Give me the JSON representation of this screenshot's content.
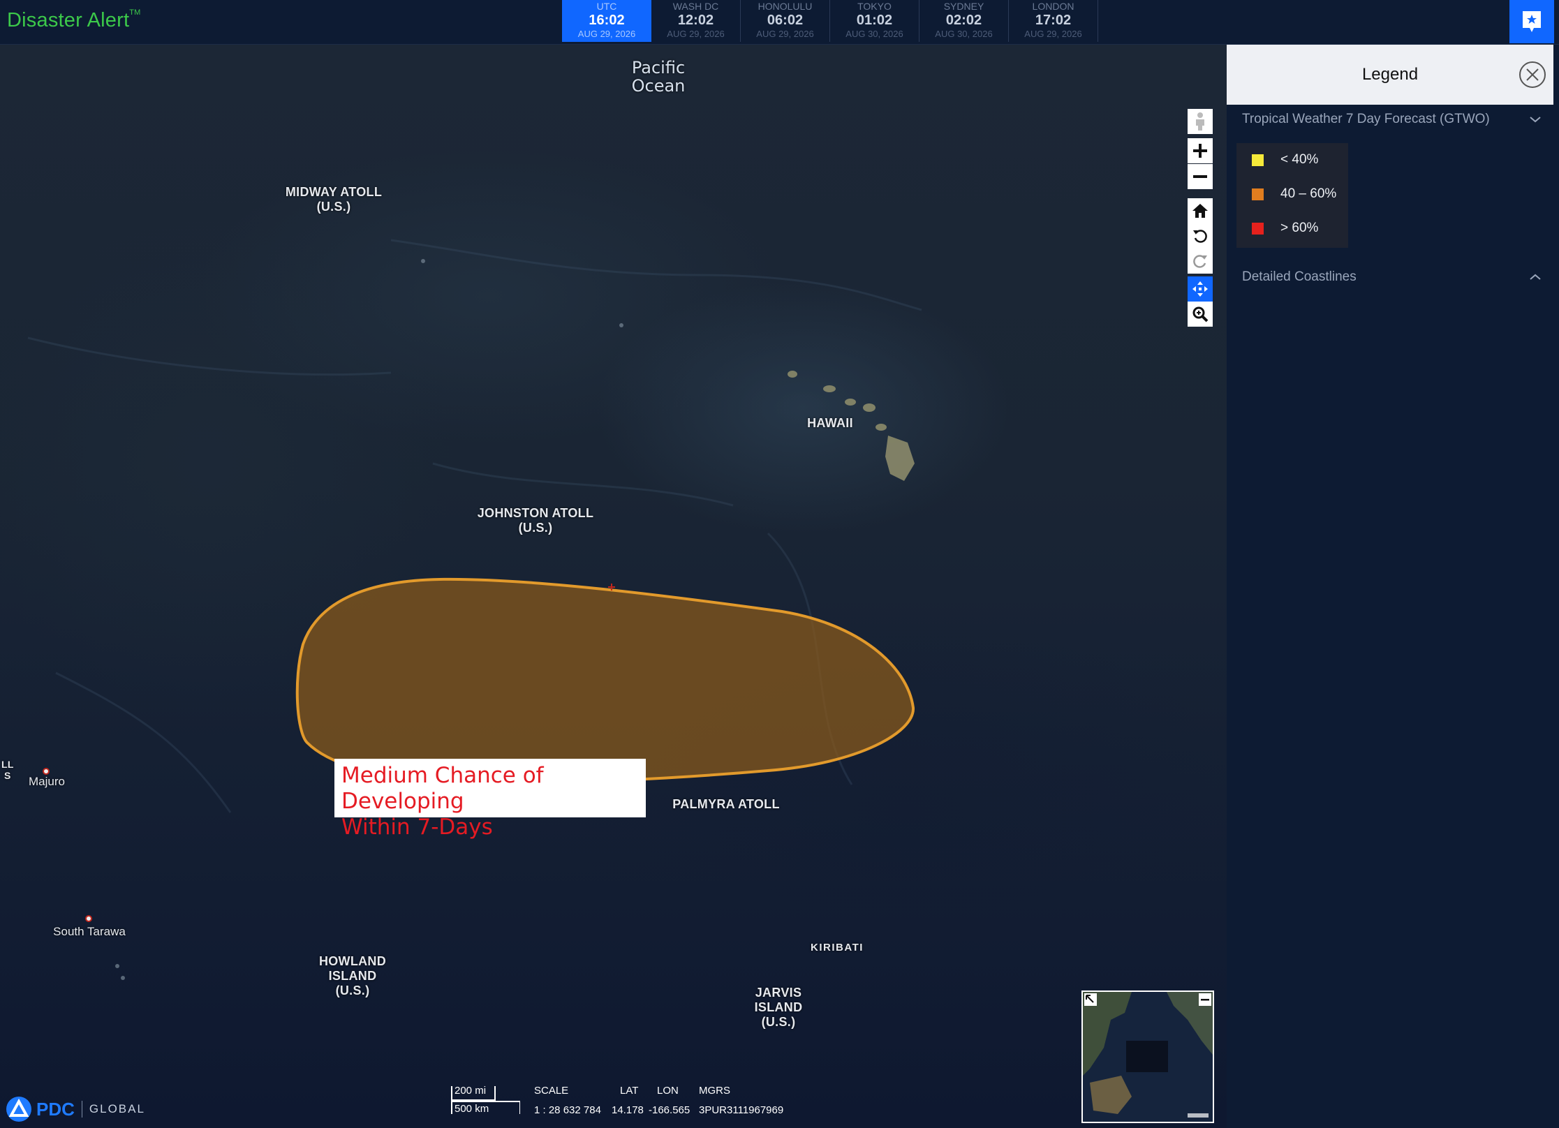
{
  "app": {
    "title": "Disaster Alert",
    "trademark": "TM"
  },
  "clocks": [
    {
      "city": "UTC",
      "time": "16:02",
      "date": "AUG 29, 2026",
      "active": true
    },
    {
      "city": "WASH DC",
      "time": "12:02",
      "date": "AUG 29, 2026",
      "active": false
    },
    {
      "city": "HONOLULU",
      "time": "06:02",
      "date": "AUG 29, 2026",
      "active": false
    },
    {
      "city": "TOKYO",
      "time": "01:02",
      "date": "AUG 30, 2026",
      "active": false
    },
    {
      "city": "SYDNEY",
      "time": "02:02",
      "date": "AUG 30, 2026",
      "active": false
    },
    {
      "city": "LONDON",
      "time": "17:02",
      "date": "AUG 29, 2026",
      "active": false
    }
  ],
  "map": {
    "ocean_label_line1": "Pacific",
    "ocean_label_line2": "Ocean",
    "labels": {
      "midway": {
        "name": "MIDWAY ATOLL",
        "sub": "(U.S.)"
      },
      "hawaii": {
        "name": "HAWAII"
      },
      "johnston": {
        "name": "JOHNSTON ATOLL",
        "sub": "(U.S.)"
      },
      "palmyra": {
        "name": "PALMYRA ATOLL"
      },
      "kiribati": {
        "name": "KIRIBATI"
      },
      "howland": {
        "name": "HOWLAND",
        "sub1": "ISLAND",
        "sub2": "(U.S.)"
      },
      "jarvis": {
        "name": "JARVIS",
        "sub1": "ISLAND",
        "sub2": "(U.S.)"
      }
    },
    "cities": {
      "majuro": "Majuro",
      "south_tarawa": "South Tarawa"
    },
    "edge_label": "LL\nS",
    "forecast_area": {
      "chance": "40 – 60%",
      "color": "#c98a2b"
    },
    "callout_line1": "Medium Chance of Developing",
    "callout_line2": "Within 7-Days"
  },
  "controls": {
    "icons": [
      "street-view-icon",
      "zoom-in-icon",
      "zoom-out-icon",
      "home-icon",
      "rotate-left-icon",
      "rotate-right-icon",
      "pan-icon",
      "zoom-box-icon"
    ]
  },
  "footer": {
    "logo_text": "PDC",
    "logo_sub": "GLOBAL",
    "scale_mi": "200 mi",
    "scale_km": "500 km",
    "scale_label": "SCALE",
    "scale_value": "1 : 28 632 784",
    "lat_label": "LAT",
    "lat_value": "14.178",
    "lon_label": "LON",
    "lon_value": "-166.565",
    "mgrs_label": "MGRS",
    "mgrs_value": "3PUR3111967969"
  },
  "legend": {
    "title": "Legend",
    "section1": "Tropical Weather 7 Day Forecast (GTWO)",
    "items": [
      {
        "label": "< 40%",
        "color": "#f5e93a"
      },
      {
        "label": "40 – 60%",
        "color": "#e07d1f"
      },
      {
        "label": "> 60%",
        "color": "#e5211d"
      }
    ],
    "section2": "Detailed Coastlines"
  },
  "colors": {
    "accent": "#1067ff",
    "brand_green": "#3cc94a",
    "panel_bg": "#0d1b33"
  }
}
